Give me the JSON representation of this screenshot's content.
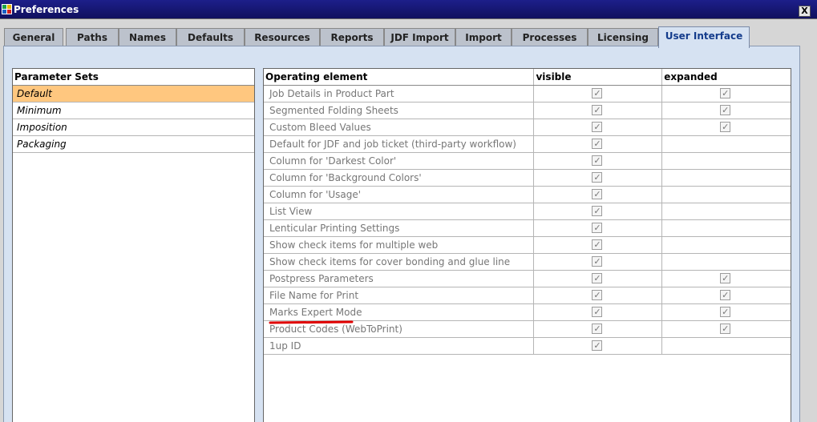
{
  "window": {
    "title": "Preferences",
    "close_label": "X"
  },
  "tabs": [
    {
      "label": "General"
    },
    {
      "label": "Paths"
    },
    {
      "label": "Names"
    },
    {
      "label": "Defaults"
    },
    {
      "label": "Resources"
    },
    {
      "label": "Reports"
    },
    {
      "label": "JDF Import"
    },
    {
      "label": "Import"
    },
    {
      "label": "Processes"
    },
    {
      "label": "Licensing"
    },
    {
      "label": "User Interface",
      "active": true
    }
  ],
  "parameter_sets": {
    "header": "Parameter Sets",
    "items": [
      {
        "label": "Default",
        "selected": true
      },
      {
        "label": "Minimum"
      },
      {
        "label": "Imposition"
      },
      {
        "label": "Packaging"
      }
    ]
  },
  "operating_table": {
    "columns": [
      "Operating element",
      "visible",
      "expanded"
    ],
    "rows": [
      {
        "name": "Job Details in Product Part",
        "visible": true,
        "expanded": true
      },
      {
        "name": "Segmented Folding Sheets",
        "visible": true,
        "expanded": true
      },
      {
        "name": "Custom Bleed Values",
        "visible": true,
        "expanded": true
      },
      {
        "name": "Default for JDF and job ticket (third-party workflow)",
        "visible": true,
        "expanded": null
      },
      {
        "name": "Column for 'Darkest Color'",
        "visible": true,
        "expanded": null
      },
      {
        "name": "Column for 'Background Colors'",
        "visible": true,
        "expanded": null
      },
      {
        "name": "Column for 'Usage'",
        "visible": true,
        "expanded": null
      },
      {
        "name": "List View",
        "visible": true,
        "expanded": null
      },
      {
        "name": "Lenticular Printing Settings",
        "visible": true,
        "expanded": null
      },
      {
        "name": "Show check items for multiple web",
        "visible": true,
        "expanded": null
      },
      {
        "name": "Show check items for cover bonding and glue line",
        "visible": true,
        "expanded": null
      },
      {
        "name": "Postpress Parameters",
        "visible": true,
        "expanded": true
      },
      {
        "name": "File Name for Print",
        "visible": true,
        "expanded": true
      },
      {
        "name": "Marks Expert Mode",
        "visible": true,
        "expanded": true
      },
      {
        "name": "Product Codes (WebToPrint)",
        "visible": true,
        "expanded": true
      },
      {
        "name": "1up ID",
        "visible": true,
        "expanded": null
      }
    ]
  },
  "colors": {
    "title_bar": "#10105e",
    "selected_row": "#ffc77f",
    "panel_bg": "#d6e2f2",
    "annotation": "#e00000"
  },
  "icons": {
    "app": "app-grid-icon",
    "check": "checkmark-icon",
    "close": "close-icon"
  },
  "glyphs": {
    "check": "✓"
  }
}
